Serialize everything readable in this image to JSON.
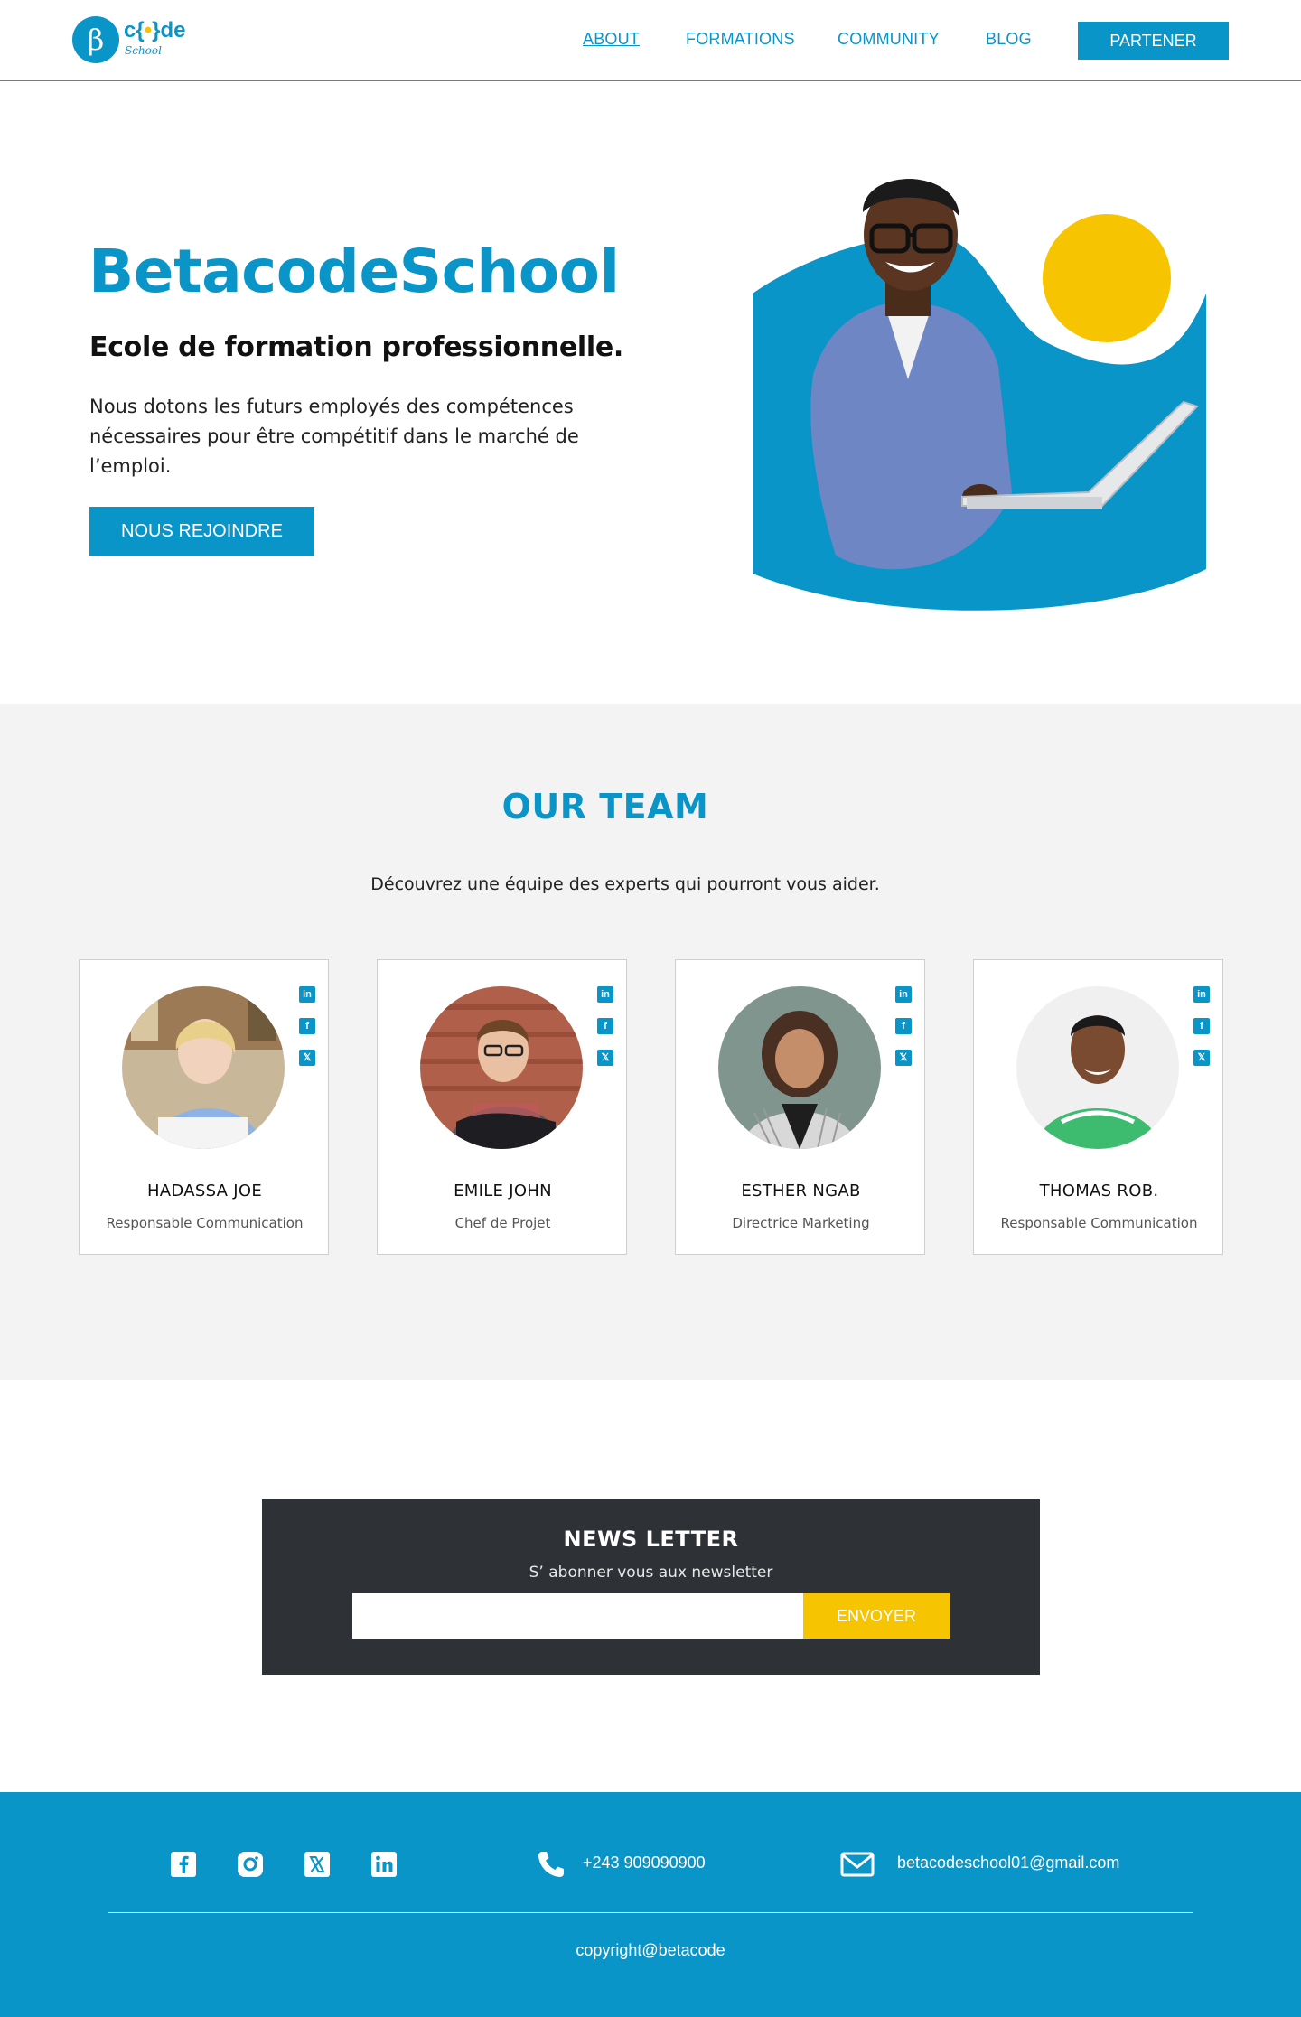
{
  "brand": {
    "logo_letter": "β",
    "logo_word_start": "c",
    "logo_word_brace_open": "{",
    "logo_word_dot": "•",
    "logo_word_brace_close": "}",
    "logo_word_end": "de",
    "logo_sub": "School"
  },
  "nav": {
    "about": "ABOUT",
    "formations": "FORMATIONS",
    "community": "COMMUNITY",
    "blog": "BLOG",
    "partner": "PARTENER"
  },
  "hero": {
    "title": "BetacodeSchool",
    "subtitle": "Ecole de formation professionnelle.",
    "text": "Nous dotons les futurs employés des compétences nécessaires pour être compétitif dans le marché de l’emploi.",
    "cta": "NOUS REJOINDRE"
  },
  "team": {
    "title": "OUR TEAM",
    "subtitle": "Découvrez une équipe des experts qui pourront vous aider.",
    "members": [
      {
        "name": "HADASSA JOE",
        "role": "Responsable Communication"
      },
      {
        "name": "EMILE JOHN",
        "role": "Chef de Projet"
      },
      {
        "name": "ESTHER NGAB",
        "role": "Directrice Marketing"
      },
      {
        "name": "THOMAS ROB.",
        "role": "Responsable Communication"
      }
    ],
    "social_labels": {
      "linkedin": "in",
      "facebook": "f",
      "x": "𝕏"
    }
  },
  "newsletter": {
    "title": "NEWS LETTER",
    "subtitle": "S’ abonner vous aux newsletter",
    "input_value": "",
    "button": "ENVOYER"
  },
  "footer": {
    "phone": "+243 909090900",
    "email": "betacodeschool01@gmail.com",
    "copyright": "copyright@betacode"
  },
  "colors": {
    "primary": "#0a95c9",
    "accent": "#f6c400",
    "dark": "#2e3236",
    "team_bg": "#f3f3f3"
  },
  "icons": [
    "facebook-icon",
    "instagram-icon",
    "x-icon",
    "linkedin-icon",
    "phone-icon",
    "mail-icon"
  ]
}
